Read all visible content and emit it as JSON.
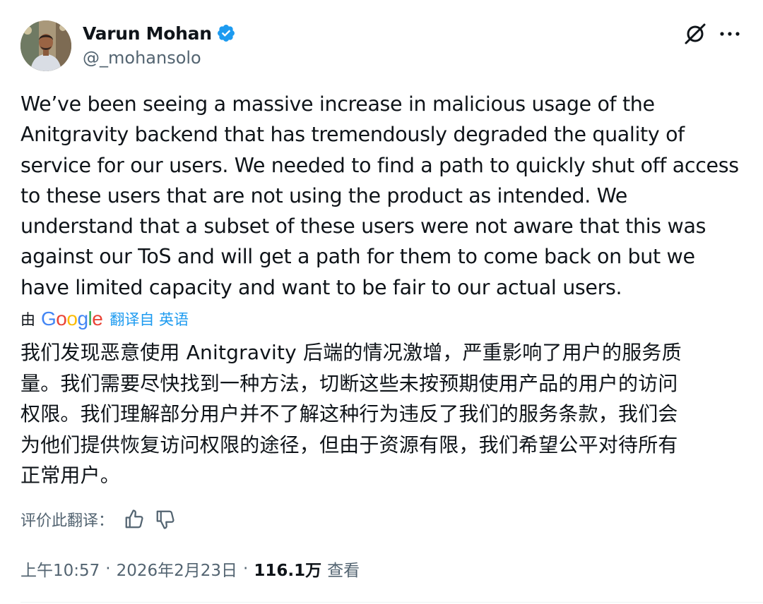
{
  "author": {
    "display_name": "Varun Mohan",
    "handle": "@_mohansolo",
    "verified": true,
    "verified_color": "#1d9bf0"
  },
  "icons": {
    "grok": "grok-icon",
    "more": "more-horizontal-icon",
    "thumb_up": "thumbs-up-icon",
    "thumb_down": "thumbs-down-icon"
  },
  "body_en_lines": [
    "We’ve been seeing a massive increase in malicious usage of the",
    "Anitgravity backend that has tremendously degraded the quality of",
    "service for our users. We needed to find a path to quickly shut off access",
    "to these users that are not using the product as intended. We",
    "understand that a subset of these users were not aware that this was",
    "against our ToS and will get a path for them to come back on but we",
    "have limited capacity and want to be fair to our actual users."
  ],
  "translation": {
    "by": "由",
    "provider": "Google",
    "link": "翻译自 英语",
    "lines": [
      "我们发现恶意使用 Anitgravity 后端的情况激增，严重影响了用户的服务质",
      "量。我们需要尽快找到一种方法，切断这些未按预期使用产品的用户的访问",
      "权限。我们理解部分用户并不了解这种行为违反了我们的服务条款，我们会",
      "为他们提供恢复访问权限的途径，但由于资源有限，我们希望公平对待所有",
      "正常用户。"
    ],
    "rate_label": "评价此翻译："
  },
  "meta": {
    "time": "上午10:57",
    "separator": "·",
    "date": "2026年2月23日",
    "views_count": "116.1万",
    "views_label": "查看"
  },
  "colors": {
    "text": "#0f1419",
    "secondary": "#536471",
    "link": "#1d9bf0",
    "google_blue": "#4285f4",
    "google_red": "#ea4335",
    "google_yellow": "#fbbc05",
    "google_green": "#34a853"
  }
}
